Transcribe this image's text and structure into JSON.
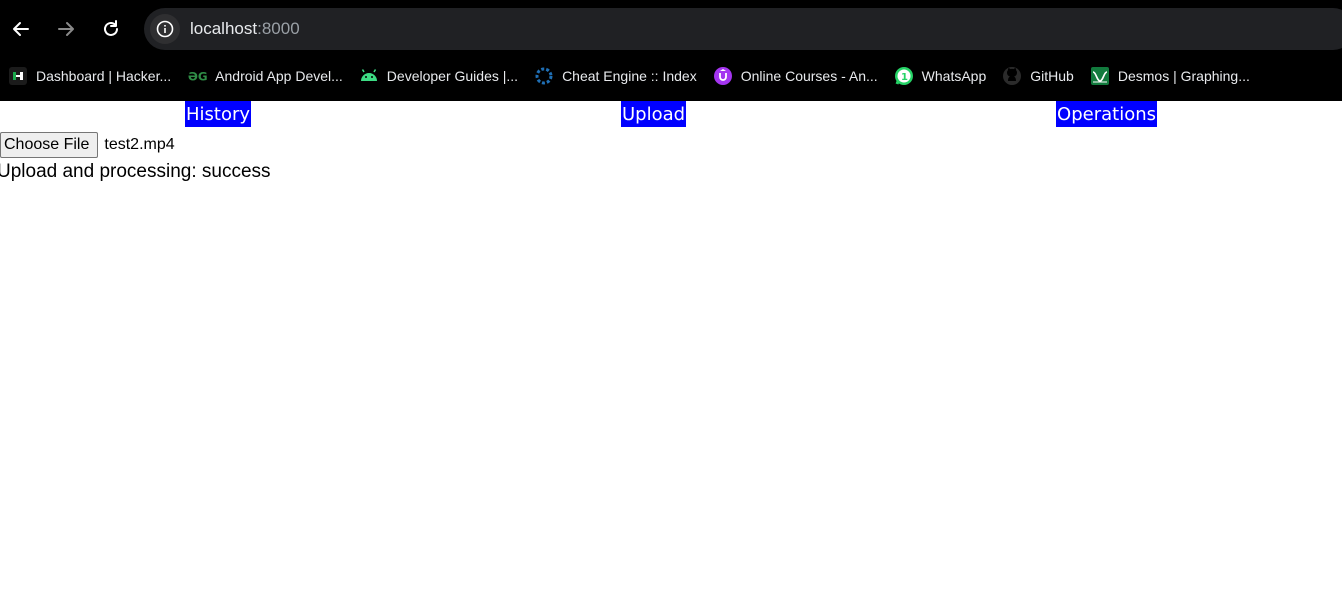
{
  "browser": {
    "url_host": "localhost",
    "url_port": ":8000",
    "bookmarks": [
      {
        "label": "Dashboard | Hacker...",
        "icon": "hackerrank-icon"
      },
      {
        "label": "Android App Devel...",
        "icon": "geeksforgeeks-icon"
      },
      {
        "label": "Developer Guides  |...",
        "icon": "android-icon"
      },
      {
        "label": "Cheat Engine :: Index",
        "icon": "cheat-engine-icon"
      },
      {
        "label": "Online Courses - An...",
        "icon": "udemy-icon"
      },
      {
        "label": "WhatsApp",
        "icon": "whatsapp-icon"
      },
      {
        "label": "GitHub",
        "icon": "github-icon"
      },
      {
        "label": "Desmos | Graphing...",
        "icon": "desmos-icon"
      }
    ]
  },
  "nav": {
    "history": "History",
    "upload": "Upload",
    "operations": "Operations"
  },
  "upload": {
    "choose_file_label": "Choose File",
    "file_name": "test2.mp4",
    "status": "Upload and processing: success"
  },
  "colors": {
    "nav_bg": "#0000ff",
    "chrome_bg": "#000000"
  }
}
